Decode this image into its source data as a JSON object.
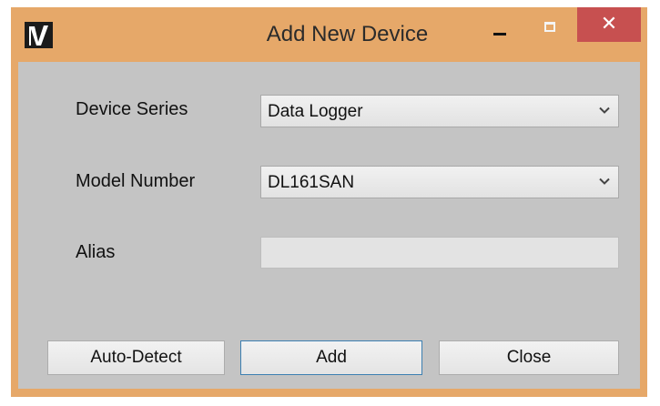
{
  "window": {
    "title": "Add New Device",
    "accent": "#e6a869",
    "close_color": "#c75050"
  },
  "form": {
    "device_series": {
      "label": "Device Series",
      "value": "Data Logger"
    },
    "model_number": {
      "label": "Model Number",
      "value": "DL161SAN"
    },
    "alias": {
      "label": "Alias",
      "value": ""
    }
  },
  "buttons": {
    "auto_detect": "Auto-Detect",
    "add": "Add",
    "close": "Close"
  },
  "icons": {
    "app": "app-logo-icon",
    "minimize": "minimize-icon",
    "maximize": "maximize-icon",
    "close": "close-icon",
    "dropdown": "chevron-down-icon"
  }
}
